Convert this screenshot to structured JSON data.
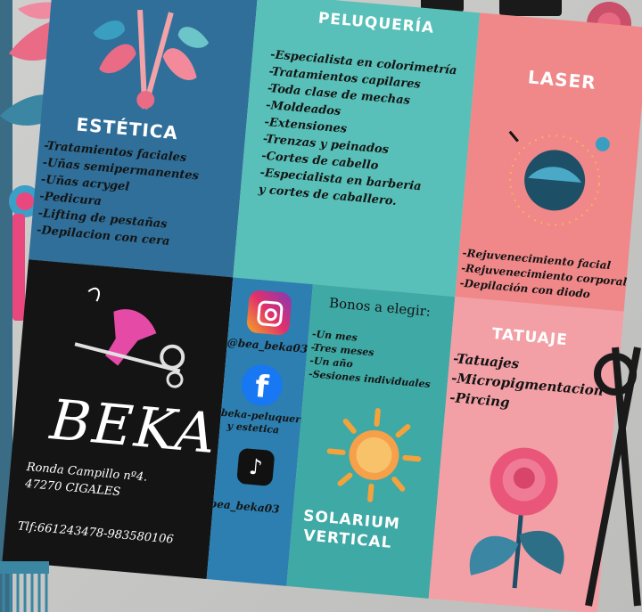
{
  "estetica": {
    "title": "ESTÉTICA",
    "items": [
      "-Tratamientos faciales",
      "-Uñas semipermanentes",
      "-Uñas acrygel",
      "-Pedicura",
      "-Lifting de pestañas",
      "-Depilacion con cera"
    ]
  },
  "peluqueria": {
    "title": "PELUQUERÍA",
    "items": [
      "-Especialista en colorimetría",
      "-Tratamientos capilares",
      "-Toda clase de mechas",
      "-Moldeados",
      "-Extensiones",
      "-Trenzas y peinados",
      "-Cortes de cabello",
      "-Especialista en barberia",
      "y cortes de caballero."
    ]
  },
  "laser": {
    "title": "LASER",
    "items": [
      "-Rejuvenecimiento facial",
      "-Rejuvenecimiento corporal",
      "-Depilación con diodo"
    ]
  },
  "beka": {
    "brand": "BEKA",
    "address1": "Ronda Campillo nº4.",
    "address2": "47270 CIGALES",
    "phone": "Tlf:661243478-983580106"
  },
  "social": {
    "instagram": "@bea_beka03",
    "facebook1": "beka-peluqueria",
    "facebook2": "y estetica",
    "tiktok": "@bea_beka03"
  },
  "bonos": {
    "title": "Bonos a elegir:",
    "items": [
      "-Un mes",
      "-Tres meses",
      "-Un año",
      "-Sesiones individuales"
    ]
  },
  "solarium": {
    "line1": "SOLARIUM",
    "line2": "VERTICAL"
  },
  "tatuaje": {
    "title": "TATUAJE",
    "items": [
      "-Tatuajes",
      "-Micropigmentacion",
      "-Pircing"
    ]
  },
  "colors": {
    "estetica_bg": "#2f6f9a",
    "peluqueria_bg": "#58c0b8",
    "laser_bg": "#f0888a",
    "beka_bg": "#141414",
    "tatuaje_bg": "#f2a0a6",
    "accent_pink": "#e8487e"
  }
}
